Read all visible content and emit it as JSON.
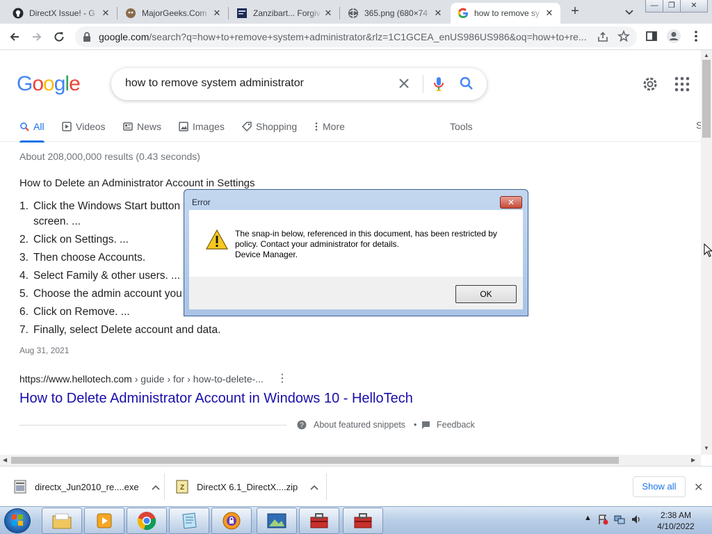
{
  "browser": {
    "tabs": [
      {
        "title": "DirectX Issue! - G"
      },
      {
        "title": "MajorGeeks.Com"
      },
      {
        "title": "Zanzibart... Forgiv"
      },
      {
        "title": "365.png (680×74"
      },
      {
        "title": "how to remove sy"
      }
    ],
    "new_tab": "+",
    "url_host": "google.com",
    "url_rest": "/search?q=how+to+remove+system+administrator&rlz=1C1GCEA_enUS986US986&oq=how+to+re..."
  },
  "google": {
    "logo_letters": [
      "G",
      "o",
      "o",
      "g",
      "l",
      "e"
    ],
    "logo_colors": [
      "#4285f4",
      "#ea4335",
      "#fbbc05",
      "#4285f4",
      "#34a853",
      "#ea4335"
    ],
    "query": "how to remove system administrator",
    "nav": {
      "all": "All",
      "videos": "Videos",
      "news": "News",
      "images": "Images",
      "shopping": "Shopping",
      "more": "More",
      "tools": "Tools",
      "truncated": "S"
    },
    "stats": "About 208,000,000 results (0.43 seconds)",
    "snippet": {
      "title": "How to Delete an Administrator Account in Settings",
      "steps": [
        {
          "num": "1.",
          "text": "Click the Windows Start button",
          "cont": "screen. ..."
        },
        {
          "num": "2.",
          "text": "Click on Settings. ..."
        },
        {
          "num": "3.",
          "text": "Then choose Accounts."
        },
        {
          "num": "4.",
          "text": "Select Family & other users. ..."
        },
        {
          "num": "5.",
          "text": "Choose the admin account you"
        },
        {
          "num": "6.",
          "text": "Click on Remove. ..."
        },
        {
          "num": "7.",
          "text": "Finally, select Delete account and data."
        }
      ],
      "date": "Aug 31, 2021",
      "cite_host": "https://www.hellotech.com",
      "cite_path": " › guide › for › how-to-delete-...",
      "link": "How to Delete Administrator Account in Windows 10 - HelloTech",
      "about": "About featured snippets",
      "bullet": "•",
      "feedback": "Feedback"
    }
  },
  "dialog": {
    "title": "Error",
    "line1": "The snap-in below, referenced in this document, has been restricted by",
    "line2": "policy. Contact your administrator for details.",
    "line3": "Device Manager.",
    "ok": "OK"
  },
  "downloads": {
    "items": [
      {
        "name": "directx_Jun2010_re....exe"
      },
      {
        "name": "DirectX 6.1_DirectX....zip"
      }
    ],
    "show_all": "Show all"
  },
  "taskbar": {
    "time": "2:38 AM",
    "date": "4/10/2022"
  },
  "colors": {
    "accent": "#1a73e8",
    "link": "#1a0dab"
  }
}
